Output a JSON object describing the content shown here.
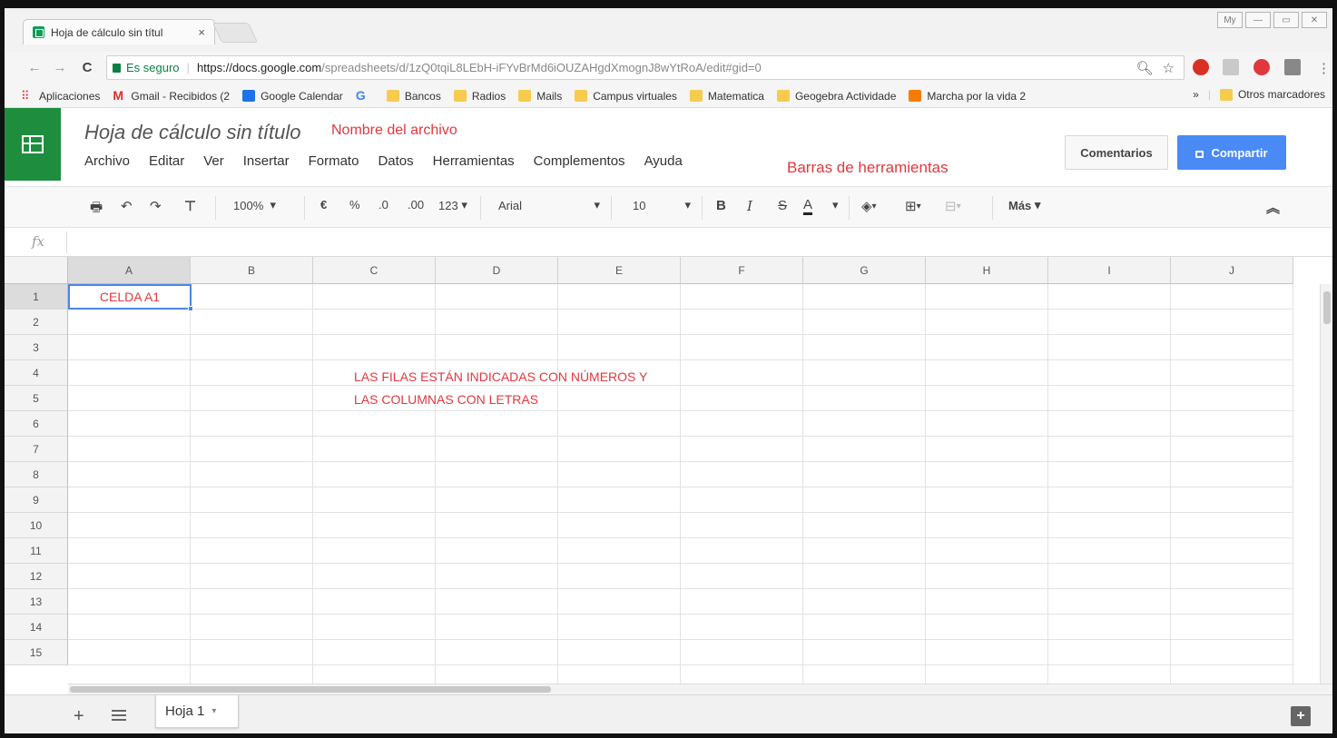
{
  "browser": {
    "tab_title": "Hoja de cálculo sin títul",
    "tab_close": "×",
    "window_buttons": [
      "My",
      "—",
      "▭",
      "✕"
    ],
    "secure_label": "Es seguro",
    "url_host": "https://docs.google.com",
    "url_rest": "/spreadsheets/d/1zQ0tqiL8LEbH-iFYvBrMd6iOUZAHgdXmognJ8wYtRoA/edit#gid=0",
    "bookmarks": [
      {
        "label": "Aplicaciones",
        "icon": "apps-grid-icon",
        "color": "#e0383e"
      },
      {
        "label": "Gmail - Recibidos (2",
        "icon": "gmail-icon",
        "color": "#d93025"
      },
      {
        "label": "Google Calendar",
        "icon": "calendar-icon",
        "color": "#1a73e8"
      },
      {
        "label": "",
        "icon": "google-icon",
        "color": "#4285f4"
      },
      {
        "label": "Bancos",
        "icon": "folder-icon",
        "color": "#f7cb4d"
      },
      {
        "label": "Radios",
        "icon": "folder-icon",
        "color": "#f7cb4d"
      },
      {
        "label": "Mails",
        "icon": "folder-icon",
        "color": "#f7cb4d"
      },
      {
        "label": "Campus virtuales",
        "icon": "folder-icon",
        "color": "#f7cb4d"
      },
      {
        "label": "Matematica",
        "icon": "folder-icon",
        "color": "#f7cb4d"
      },
      {
        "label": "Geogebra Actividade",
        "icon": "folder-icon",
        "color": "#f7cb4d"
      },
      {
        "label": "Marcha por la vida 2",
        "icon": "blogger-icon",
        "color": "#f57c00"
      }
    ],
    "more_bookmarks": "»",
    "other_bookmarks": "Otros marcadores"
  },
  "app": {
    "doc_title": "Hoja de cálculo sin título",
    "annotation_name": "Nombre del archivo",
    "annotation_toolbar": "Barras de herramientas",
    "menu": [
      "Archivo",
      "Editar",
      "Ver",
      "Insertar",
      "Formato",
      "Datos",
      "Herramientas",
      "Complementos",
      "Ayuda"
    ],
    "comments_button": "Comentarios",
    "share_button": "Compartir",
    "brand_color": "#1e8e3e",
    "share_color": "#4a8af4"
  },
  "toolbar": {
    "zoom": "100%",
    "currency": "€",
    "percent": "%",
    "dec_less": ".0",
    "dec_more": ".00",
    "number_format": "123",
    "font": "Arial",
    "font_size": "10",
    "bold": "B",
    "italic": "I",
    "strike": "S",
    "text_color": "A",
    "more": "Más"
  },
  "formula": {
    "fx_label": "fx",
    "value": ""
  },
  "grid": {
    "columns": [
      "A",
      "B",
      "C",
      "D",
      "E",
      "F",
      "G",
      "H",
      "I",
      "J"
    ],
    "rows": [
      "1",
      "2",
      "3",
      "4",
      "5",
      "6",
      "7",
      "8",
      "9",
      "10",
      "11",
      "12",
      "13",
      "14",
      "15"
    ],
    "cell_a1": "CELDA A1",
    "annotation_line1": "LAS FILAS ESTÁN INDICADAS CON NÚMEROS Y",
    "annotation_line2": "LAS COLUMNAS CON LETRAS",
    "annotation_color": "#e0383e"
  },
  "sheets": {
    "add": "+",
    "tab_label": "Hoja 1",
    "tab_dropdown": "▾"
  }
}
